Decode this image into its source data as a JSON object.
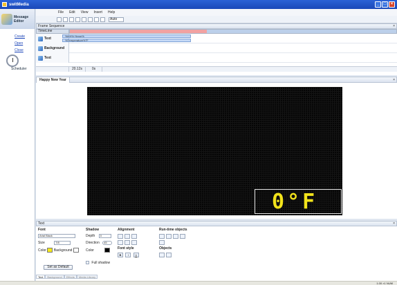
{
  "window": {
    "title": "switMedia"
  },
  "nav": {
    "header_label": "Message Editor",
    "links": [
      "Create",
      "Open",
      "Close"
    ],
    "scheduler_label": "Scheduler"
  },
  "menu": [
    "File",
    "Edit",
    "View",
    "Insert",
    "Help"
  ],
  "toolbar": {
    "zoom_value": "Auto"
  },
  "frame_sequence": {
    "title": "Frame Sequence",
    "timeline_label": "TimeLine",
    "tracks": [
      {
        "name": "Text",
        "clips": [
          "%HH%:%mm%",
          "%Temperature%°F"
        ]
      },
      {
        "name": "Background",
        "clips": []
      },
      {
        "name": "Text",
        "clips": []
      }
    ],
    "footer": [
      "20.12s",
      "0s"
    ]
  },
  "preview": {
    "tab_title": "Happy New Year",
    "led_text": "0°F",
    "led_color": "#f2e31b"
  },
  "text_panel": {
    "title": "Text",
    "font": {
      "label": "Font",
      "name": "Arial Black",
      "size_label": "Size",
      "size_value": "7/8",
      "color_label": "Color",
      "background_label": "Background",
      "color": "#f7ea1a",
      "set_default": "Set as Default"
    },
    "shadow": {
      "label": "Shadow",
      "depth_label": "Depth",
      "depth_value": "0",
      "direction_label": "Direction",
      "direction_value": "45",
      "color_label": "Color",
      "full_shadow_label": "Full shadow"
    },
    "alignment": {
      "label": "Alignment",
      "font_style_label": "Font style",
      "font_style_buttons": [
        "B",
        "I",
        "U"
      ]
    },
    "runtime": {
      "label": "Run-time objects",
      "objects_label": "Objects"
    },
    "bottom_tabs": [
      "Text",
      "Background",
      "Effects",
      "Media Library"
    ]
  },
  "status": {
    "right_text": "1.00 ×1 NUM"
  }
}
